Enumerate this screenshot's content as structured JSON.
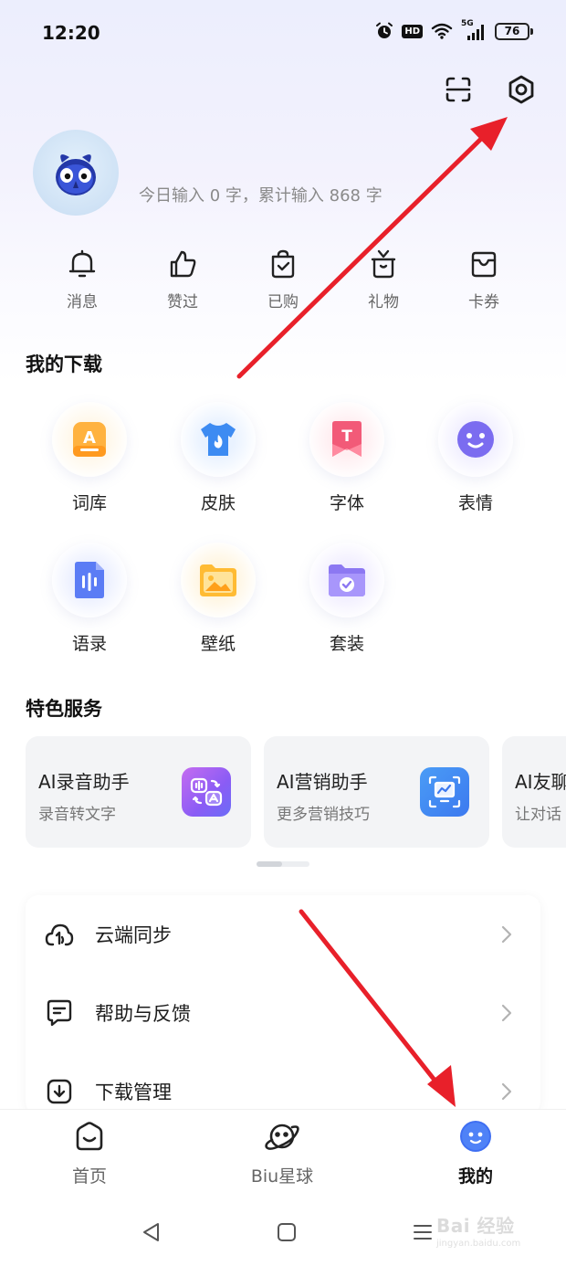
{
  "status_bar": {
    "time": "12:20",
    "hd_badge": "HD",
    "network": "5G",
    "battery": "76",
    "icons": [
      "alarm-icon",
      "hd-icon",
      "wifi-icon",
      "5g-signal-icon",
      "battery-icon"
    ]
  },
  "header": {
    "scan_icon": "scan-icon",
    "settings_icon": "settings-icon",
    "input_stats": "今日输入 0 字，累计输入 868 字"
  },
  "quick_actions": [
    {
      "label": "消息",
      "icon": "bell-icon"
    },
    {
      "label": "赞过",
      "icon": "thumbs-up-icon"
    },
    {
      "label": "已购",
      "icon": "shopping-bag-icon"
    },
    {
      "label": "礼物",
      "icon": "gift-icon"
    },
    {
      "label": "卡券",
      "icon": "coupon-icon"
    }
  ],
  "downloads": {
    "title": "我的下载",
    "items": [
      {
        "label": "词库",
        "icon": "dictionary-icon",
        "color": "#ffb23f"
      },
      {
        "label": "皮肤",
        "icon": "skin-icon",
        "color": "#3d8bf2"
      },
      {
        "label": "字体",
        "icon": "font-icon",
        "color": "#f25a78"
      },
      {
        "label": "表情",
        "icon": "emoji-icon",
        "color": "#7b6cf0"
      },
      {
        "label": "语录",
        "icon": "quotes-icon",
        "color": "#5b7cf5"
      },
      {
        "label": "壁纸",
        "icon": "wallpaper-icon",
        "color": "#ffbb33"
      },
      {
        "label": "套装",
        "icon": "bundle-icon",
        "color": "#8c78f2"
      }
    ]
  },
  "services": {
    "title": "特色服务",
    "cards": [
      {
        "title": "AI录音助手",
        "subtitle": "录音转文字",
        "icon": "voice-translate-icon"
      },
      {
        "title": "AI营销助手",
        "subtitle": "更多营销技巧",
        "icon": "marketing-chart-icon"
      },
      {
        "title": "AI友聊",
        "subtitle": "让对话",
        "icon": "chat-icon"
      }
    ]
  },
  "menu": [
    {
      "label": "云端同步",
      "icon": "cloud-sync-icon"
    },
    {
      "label": "帮助与反馈",
      "icon": "feedback-icon"
    },
    {
      "label": "下载管理",
      "icon": "download-manage-icon"
    }
  ],
  "tabbar": {
    "tabs": [
      {
        "label": "首页",
        "icon": "home-icon",
        "active": false
      },
      {
        "label": "Biu星球",
        "icon": "planet-icon",
        "active": false
      },
      {
        "label": "我的",
        "icon": "me-icon",
        "active": true
      }
    ]
  },
  "watermark": {
    "main": "Bai 经验",
    "sub": "jingyan.baidu.com"
  }
}
